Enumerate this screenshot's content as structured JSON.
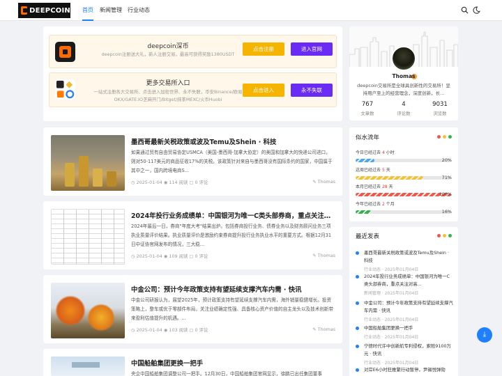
{
  "brand": {
    "name": "DEEPCOIN"
  },
  "nav": {
    "home": "首页",
    "news": "新闻管理",
    "industry": "行业动态"
  },
  "ads": [
    {
      "title": "deepcoin深币",
      "sub": "deepcoin注册送大礼，新人注册交易，最高可获得奖励1380USDT",
      "btn1": "点击注册",
      "btn2": "进入官网"
    },
    {
      "title": "更多交易所入口",
      "sub": "一站式注册各大交易所、点击进入加密世界、永不失联，币安Binance/欧易OKX/GATE.IO芝麻开门/Bitget/抹茶MEXC/火币Huobi",
      "btn1": "点击进入",
      "btn2": "永不失联"
    }
  ],
  "posts": [
    {
      "title": "墨西哥最新关税政策或波及Temu及Shein · 科技",
      "excerpt": "如果通过贸有自由贸易协定USMCA（美国-墨西哥-加拿大协定）的美国和加拿大的快递公司进口，则对50-117美元的商品征收17%的关税。该政策针对来自与墨西哥没有国际条约的国家，中国属于其中之一，国内跨境电商S...",
      "date": "2025-01-04",
      "views": "114 阅读",
      "comments": "0 评论",
      "author": "Thomas"
    },
    {
      "title": "2024年投行业务成绩单：中国银河为唯一C类头部券商，重点关注对高...",
      "excerpt": "2024年最后一日，券商\"年度大考\"结果出炉。包括券商投行业务、债券业务以及财务顾问业务三项执业质量评价结果。执业质量评价是激励约束券商提升投行业务执业水平的重要方式。根据12月31日中证协官网发布的情况，三大稳...",
      "date": "2025-01-04",
      "views": "109 阅读",
      "comments": "0 评论",
      "author": "Thomas"
    },
    {
      "title": "中金公司：预计今年政策支持有望延续支撑汽车内需 · 快讯",
      "excerpt": "中金公司研报认为，展望2025年，预计政策支持有望延续支撑汽车内需，海外销量稳健增长。投资策略上，整车或优于零部件布局，关注业绩确定性强、具备核心资产价值的自主龙头以及技术创新带来盈利估值提升的机遇。...",
      "date": "2025-01-04",
      "views": "103 阅读",
      "comments": "0 评论",
      "author": "Thomas"
    },
    {
      "title": "中国船舶集团更换一把手",
      "excerpt": "央企中国船舶集团调整公司一把手。12月30日，中国船舶集团官网显示，徐鹏已出任集团董事",
      "date": "",
      "views": "",
      "comments": "",
      "author": ""
    }
  ],
  "profile": {
    "name": "Thomas",
    "bio": "deepcoin交易所是全球具创新性的交易所！坚持用户至上的经营理念，深度创新，长...",
    "stats": [
      {
        "num": "767",
        "label": "文章数"
      },
      {
        "num": "4",
        "label": "评论数"
      },
      {
        "num": "9031",
        "label": "浏览数"
      }
    ]
  },
  "timeflow": {
    "title": "似水流年",
    "rows": [
      {
        "prefix": "今日已经过去",
        "value": "4",
        "unit": "小时",
        "percent": "20%",
        "fill": 0.2,
        "color": "#4aa8f0"
      },
      {
        "prefix": "这周已经过去",
        "value": "5",
        "unit": "天",
        "percent": "71%",
        "fill": 0.71,
        "color": "#f2c230"
      },
      {
        "prefix": "本月已经过去",
        "value": "28",
        "unit": "天",
        "percent": "100%",
        "fill": 1.0,
        "color": "#f0564a"
      },
      {
        "prefix": "今年已经过去",
        "value": "2",
        "unit": "个月",
        "percent": "16%",
        "fill": 0.16,
        "color": "#34b24c"
      }
    ]
  },
  "recent": {
    "title": "最近发表",
    "items": [
      {
        "title": "墨西哥最新关税政策或波及Temu及Shein · 科技",
        "meta": "行业动态  ·  2025年01月04日"
      },
      {
        "title": "2024年投行业务成绩单：中国银河为唯一C类头部券商，重点关注对高...",
        "meta": "新闻管理  ·  2025年01月04日"
      },
      {
        "title": "中金公司：预计今年政策支持有望延续支撑汽车内需 · 快讯",
        "meta": "行业动态  ·  2025年01月04日"
      },
      {
        "title": "中国船舶集团更换一把手",
        "meta": "行业动态  ·  2025年01月04日"
      },
      {
        "title": "宁德时代许中创新航专利侵权，索赔9100万元 · 快讯",
        "meta": "行业动态  ·  2025年01月04日"
      },
      {
        "title": "对岸E6小时狂推繁行动暂停，尹锡悦弹劾",
        "meta": ""
      }
    ]
  },
  "colors": {
    "accent": "#1e80ff",
    "yellow": "#f5b400",
    "purple": "#6a2cf5"
  }
}
